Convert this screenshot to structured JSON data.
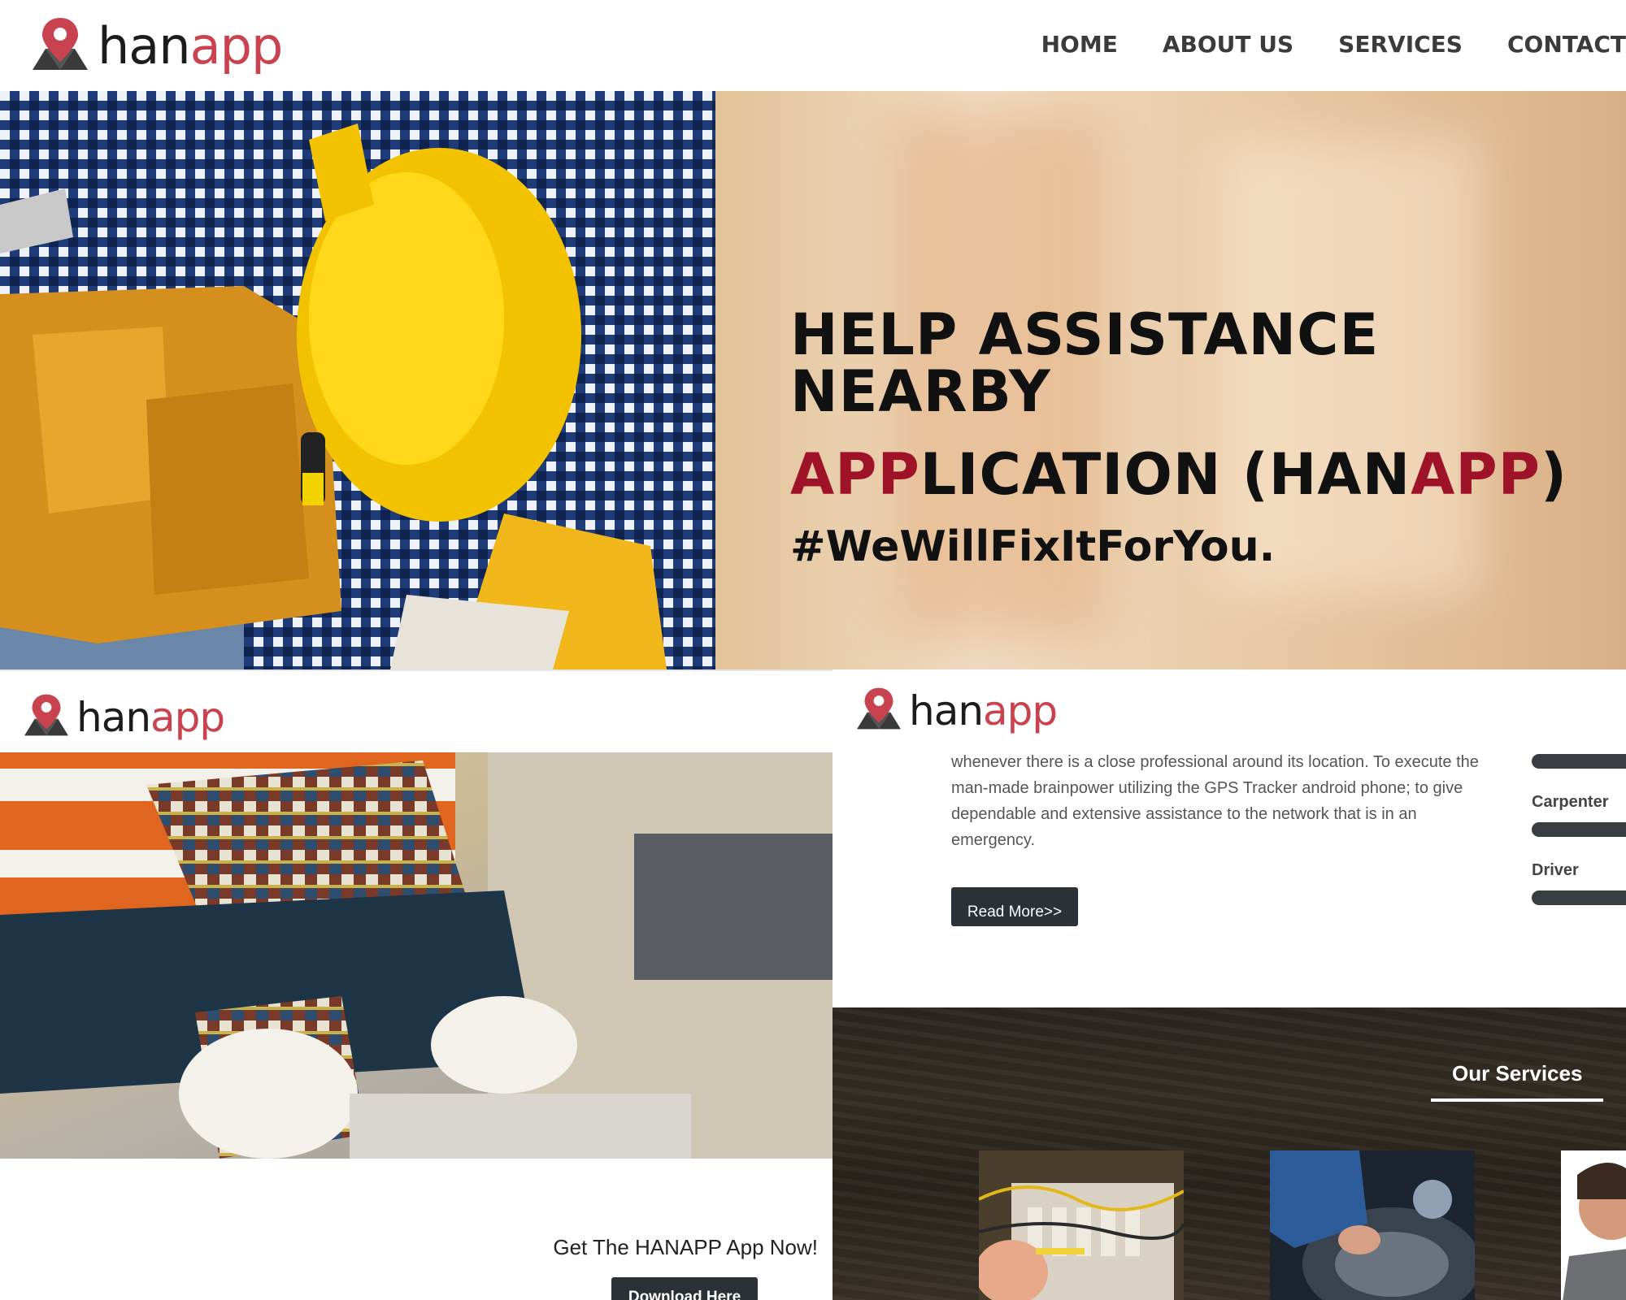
{
  "brand": {
    "name_part1": "han",
    "name_part2": "app"
  },
  "nav": {
    "items": [
      "HOME",
      "ABOUT US",
      "SERVICES",
      "CONTACT"
    ]
  },
  "hero": {
    "line1": "HELP ASSISTANCE NEARBY",
    "line2_red1": "APP",
    "line2_black1": "LICATION (HAN",
    "line2_red2": "APP",
    "line2_black2": ")",
    "hashtag": "#WeWillFixItForYou."
  },
  "download": {
    "cta_text": "Get The HANAPP App Now!",
    "button_label": "Download Here"
  },
  "about": {
    "text": "whenever there is a close professional around its location. To execute the man-made brainpower utilizing the GPS Tracker android phone; to give dependable and extensive assistance to the network that is in an emergency.",
    "read_more_label": "Read More>>"
  },
  "skills": {
    "items": [
      "Carpenter",
      "Driver"
    ]
  },
  "services": {
    "title": "Our Services"
  },
  "colors": {
    "brand_red": "#c8424f",
    "hero_red": "#9e1328",
    "button_dark": "#2c3037"
  }
}
